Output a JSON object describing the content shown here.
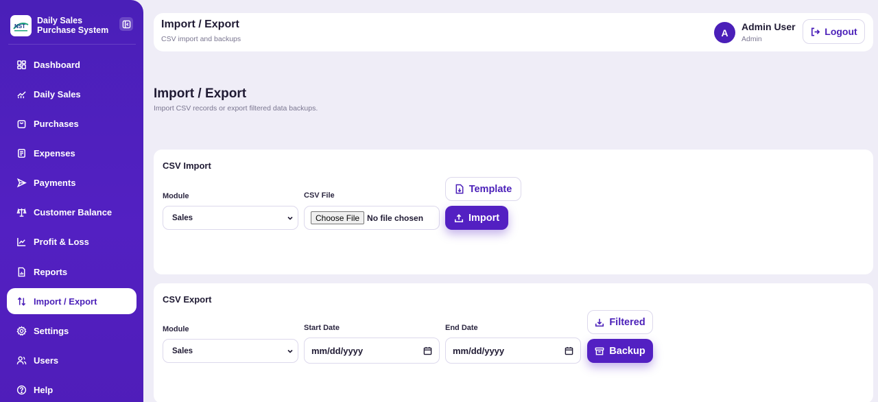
{
  "app": {
    "name": "Daily Sales Purchase System",
    "logo_text": "NST"
  },
  "sidebar": {
    "items": [
      {
        "label": "Dashboard",
        "icon": "grid-icon"
      },
      {
        "label": "Daily Sales",
        "icon": "trend-icon"
      },
      {
        "label": "Purchases",
        "icon": "bag-icon"
      },
      {
        "label": "Expenses",
        "icon": "receipt-icon"
      },
      {
        "label": "Payments",
        "icon": "send-icon"
      },
      {
        "label": "Customer Balance",
        "icon": "scale-icon"
      },
      {
        "label": "Profit & Loss",
        "icon": "line-chart-icon"
      },
      {
        "label": "Reports",
        "icon": "report-icon"
      },
      {
        "label": "Import / Export",
        "icon": "swap-icon",
        "active": true
      },
      {
        "label": "Settings",
        "icon": "gear-icon"
      },
      {
        "label": "Users",
        "icon": "users-icon"
      },
      {
        "label": "Help",
        "icon": "help-icon"
      }
    ]
  },
  "header": {
    "title": "Import / Export",
    "subtitle": "CSV import and backups",
    "avatar_initial": "A",
    "user_name": "Admin User",
    "user_role": "Admin",
    "logout_label": "Logout"
  },
  "page": {
    "title": "Import / Export",
    "subtitle": "Import CSV records or export filtered data backups."
  },
  "csv_import": {
    "title": "CSV Import",
    "module_label": "Module",
    "module_value": "Sales",
    "file_label": "CSV File",
    "choose_file_label": "Choose File",
    "no_file_text": "No file chosen",
    "template_label": "Template",
    "import_label": "Import"
  },
  "csv_export": {
    "title": "CSV Export",
    "module_label": "Module",
    "module_value": "Sales",
    "start_date_label": "Start Date",
    "start_date_placeholder": "mm/dd/yyyy",
    "end_date_label": "End Date",
    "end_date_placeholder": "mm/dd/yyyy",
    "filtered_label": "Filtered",
    "backup_label": "Backup"
  },
  "colors": {
    "accent": "#5320c2",
    "sidebar_bg": "#4a1fb8",
    "page_bg": "#efedf7"
  }
}
